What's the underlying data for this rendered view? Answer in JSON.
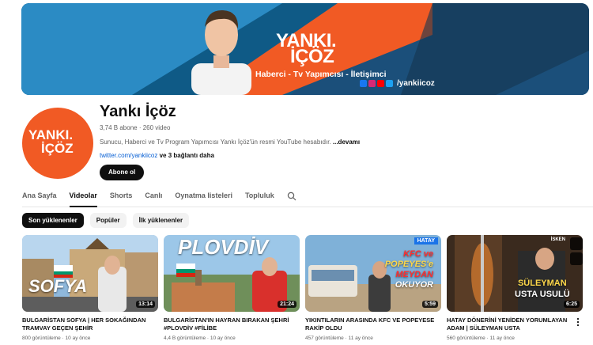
{
  "banner": {
    "logo_line1": "YANKI.",
    "logo_line2": "İÇÖZ",
    "tagline": "Haberci - Tv Yapımcısı - İletişimci",
    "handle": "/yankiicoz",
    "colors": {
      "blue": "#0f5a86",
      "orange": "#f15a24",
      "dark": "#1a1a2e"
    }
  },
  "channel": {
    "avatar_line1": "YANKI.",
    "avatar_line2": "İÇÖZ",
    "name": "Yankı İçöz",
    "meta": "3,74 B abone · 260 video",
    "description": "Sunucu, Haberci ve Tv Program Yapımcısı Yankı İçöz'ün resmi YouTube hesabıdır.",
    "more_label": "...devamı",
    "link_text": "twitter.com/yankiicoz",
    "link_suffix": "ve 3 bağlantı daha",
    "subscribe_label": "Abone ol"
  },
  "tabs": [
    {
      "label": "Ana Sayfa",
      "active": false
    },
    {
      "label": "Videolar",
      "active": true
    },
    {
      "label": "Shorts",
      "active": false
    },
    {
      "label": "Canlı",
      "active": false
    },
    {
      "label": "Oynatma listeleri",
      "active": false
    },
    {
      "label": "Topluluk",
      "active": false
    }
  ],
  "chips": [
    {
      "label": "Son yüklenenler",
      "active": true
    },
    {
      "label": "Popüler",
      "active": false
    },
    {
      "label": "İlk yüklenenler",
      "active": false
    }
  ],
  "videos": [
    {
      "overlay": "SOFYA",
      "duration": "13:14",
      "title": "BULGARİSTAN SOFYA | HER SOKAĞINDAN TRAMVAY GEÇEN ŞEHİR",
      "meta": "800 görüntüleme · 10 ay önce"
    },
    {
      "overlay": "PLOVDİV",
      "duration": "21:24",
      "title": "BULGARİSTAN'IN HAYRAN BIRAKAN ŞEHRİ #PLOVDİV #FİLİBE",
      "meta": "4,4 B görüntüleme · 10 ay önce"
    },
    {
      "overlay_tag": "HATAY",
      "overlay_line1": "KFC ve",
      "overlay_line2": "POPEYES'e",
      "overlay_line3": "MEYDAN",
      "overlay_line4": "OKUYOR",
      "duration": "5:59",
      "title": "YIKINTILARIN ARASINDA KFC VE POPEYESE RAKİP OLDU",
      "meta": "457 görüntüleme · 11 ay önce"
    },
    {
      "overlay_tag": "İSKEN",
      "overlay_line1": "SÜLEYMAN",
      "overlay_line2": "USTA USULÜ",
      "duration": "6:25",
      "title": "HATAY DÖNERİNİ YENİDEN YORUMLAYAN ADAM | SÜLEYMAN USTA",
      "meta": "560 görüntüleme · 11 ay önce"
    }
  ]
}
